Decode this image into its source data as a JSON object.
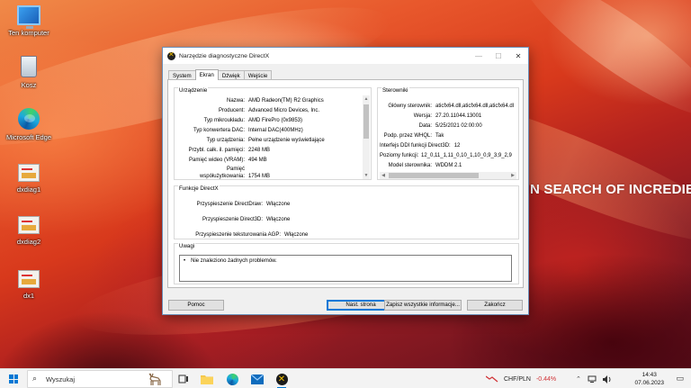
{
  "desktop": {
    "tagline": "N SEARCH OF INCREDIBLE",
    "icons": [
      {
        "label": "Ten komputer",
        "icon": "computer-icon"
      },
      {
        "label": "Kosz",
        "icon": "recycle-bin-icon"
      },
      {
        "label": "Microsoft Edge",
        "icon": "edge-icon"
      },
      {
        "label": "dxdiag1",
        "icon": "file-icon"
      },
      {
        "label": "dxdiag2",
        "icon": "file-icon"
      },
      {
        "label": "dx1",
        "icon": "file-icon"
      }
    ]
  },
  "window": {
    "title": "Narzędzie diagnostyczne DirectX",
    "tabs": [
      {
        "label": "System",
        "active": false
      },
      {
        "label": "Ekran",
        "active": true
      },
      {
        "label": "Dźwięk",
        "active": false
      },
      {
        "label": "Wejście",
        "active": false
      }
    ],
    "device": {
      "title": "Urządzenie",
      "rows": [
        {
          "key": "Nazwa:",
          "value": "AMD Radeon(TM) R2 Graphics"
        },
        {
          "key": "Producent:",
          "value": "Advanced Micro Devices, Inc."
        },
        {
          "key": "Typ mikroukładu:",
          "value": "AMD FirePro (0x9853)"
        },
        {
          "key": "Typ konwertera DAC:",
          "value": "Internal DAC(400MHz)"
        },
        {
          "key": "Typ urządzenia:",
          "value": "Pełne urządzenie wyświetlające"
        },
        {
          "key": "Przybl. całk. il. pamięci:",
          "value": "2248 MB"
        },
        {
          "key": "Pamięć wideo (VRAM):",
          "value": "494 MB"
        },
        {
          "key": "Pamięć",
          "value": ""
        },
        {
          "key": "współużytkowania:",
          "value": "1754 MB"
        }
      ]
    },
    "drivers": {
      "title": "Sterowniki",
      "rows": [
        {
          "key": "Główny sterownik:",
          "value": "aticfx64.dll,aticfx64.dll,aticfx64.dl"
        },
        {
          "key": "Wersja:",
          "value": "27.20.11044.13001"
        },
        {
          "key": "Data:",
          "value": "5/25/2021 02:00:00"
        },
        {
          "key": "Podp. przez WHQL:",
          "value": "Tak"
        },
        {
          "key": "Interfejs DDI funkcji Direct3D:",
          "value": "12"
        },
        {
          "key": "Poziomy funkcji:",
          "value": "12_0,11_1,11_0,10_1,10_0,9_3,9_2,9"
        },
        {
          "key": "Model sterownika:",
          "value": "WDDM 2.1"
        }
      ]
    },
    "features": {
      "title": "Funkcje DirectX",
      "rows": [
        {
          "key": "Przyspieszenie DirectDraw:",
          "value": "Włączone"
        },
        {
          "key": "Przyspieszenie Direct3D:",
          "value": "Włączone"
        },
        {
          "key": "Przyspieszenie teksturowania AGP:",
          "value": "Włączone"
        }
      ]
    },
    "notes": {
      "title": "Uwagi",
      "bullet": "•",
      "lines": [
        "Nie znaleziono żadnych problemów."
      ]
    },
    "buttons": {
      "help": "Pomoc",
      "next": "Nast. strona",
      "save": "Zapisz wszystkie informacje...",
      "close": "Zakończ"
    }
  },
  "taskbar": {
    "search_placeholder": "Wyszukaj",
    "currency": "CHF/PLN",
    "currency_change": "-0.44%",
    "currency_color": "#d13438",
    "time": "14:43",
    "date": "07.06.2023",
    "accent": "#0078d4"
  }
}
